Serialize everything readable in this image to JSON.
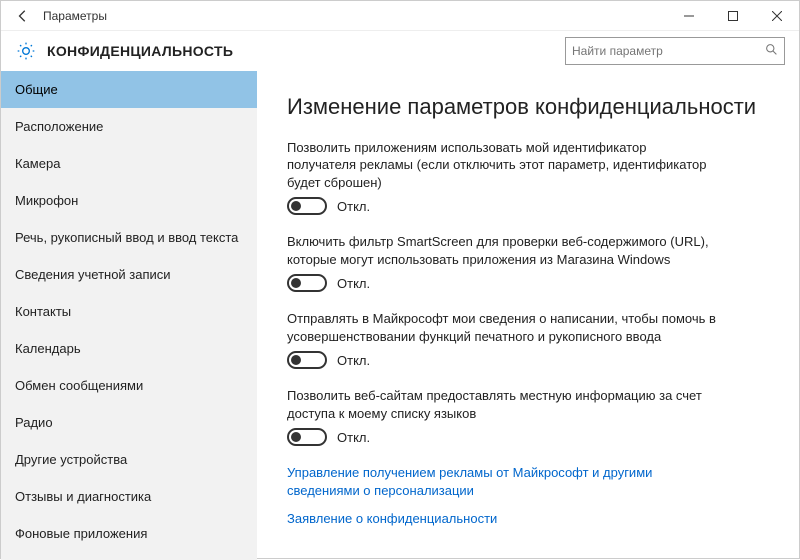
{
  "window": {
    "title": "Параметры"
  },
  "header": {
    "page_title": "КОНФИДЕНЦИАЛЬНОСТЬ",
    "search_placeholder": "Найти параметр"
  },
  "sidebar": {
    "items": [
      {
        "label": "Общие",
        "selected": true
      },
      {
        "label": "Расположение",
        "selected": false
      },
      {
        "label": "Камера",
        "selected": false
      },
      {
        "label": "Микрофон",
        "selected": false
      },
      {
        "label": "Речь, рукописный ввод и ввод текста",
        "selected": false
      },
      {
        "label": "Сведения учетной записи",
        "selected": false
      },
      {
        "label": "Контакты",
        "selected": false
      },
      {
        "label": "Календарь",
        "selected": false
      },
      {
        "label": "Обмен сообщениями",
        "selected": false
      },
      {
        "label": "Радио",
        "selected": false
      },
      {
        "label": "Другие устройства",
        "selected": false
      },
      {
        "label": "Отзывы и диагностика",
        "selected": false
      },
      {
        "label": "Фоновые приложения",
        "selected": false
      }
    ]
  },
  "main": {
    "heading": "Изменение параметров конфиденциальности",
    "settings": [
      {
        "desc": "Позволить приложениям использовать мой идентификатор получателя рекламы (если отключить этот параметр, идентификатор будет сброшен)",
        "state_label": "Откл.",
        "on": false
      },
      {
        "desc": "Включить фильтр SmartScreen для проверки веб-содержимого (URL), которые могут использовать приложения из Магазина Windows",
        "state_label": "Откл.",
        "on": false
      },
      {
        "desc": "Отправлять в Майкрософт мои сведения о написании, чтобы помочь в усовершенствовании функций печатного и рукописного ввода",
        "state_label": "Откл.",
        "on": false
      },
      {
        "desc": "Позволить веб-сайтам предоставлять местную информацию за счет доступа к моему списку языков",
        "state_label": "Откл.",
        "on": false
      }
    ],
    "links": [
      "Управление получением рекламы от Майкрософт и другими сведениями о персонализации",
      "Заявление о конфиденциальности"
    ]
  }
}
